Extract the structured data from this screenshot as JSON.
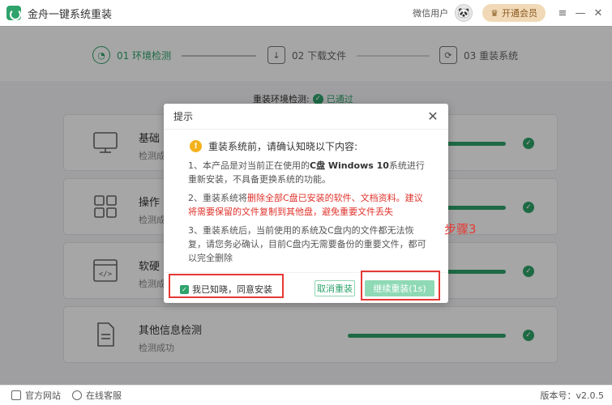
{
  "window": {
    "title": "金舟一键系统重装",
    "user_name": "微信用户",
    "vip_label": "开通会员",
    "controls": [
      "≡",
      "—",
      "✕"
    ]
  },
  "steps": [
    {
      "label": "01 环境检测",
      "active": true
    },
    {
      "label": "02 下载文件",
      "active": false
    },
    {
      "label": "03 重装系统",
      "active": false
    }
  ],
  "env": {
    "label": "重装环境检测:",
    "status": "已通过"
  },
  "cards": [
    {
      "title": "基础",
      "subtitle": "检测成",
      "icon": "monitor-icon"
    },
    {
      "title": "操作",
      "subtitle": "检测成",
      "icon": "grid-icon"
    },
    {
      "title": "软硬",
      "subtitle": "检测成",
      "icon": "code-window-icon"
    },
    {
      "title": "其他信息检测",
      "subtitle": "检测成功",
      "icon": "document-icon"
    }
  ],
  "dialog": {
    "title": "提示",
    "warning": "重装系统前，请确认知晓以下内容:",
    "p1_a": "1、本产品是对当前正在使用的",
    "p1_b": "C盘 Windows 10",
    "p1_c": "系统进行重新安装，不具备更换系统的功能。",
    "p2_a": "2、重装系统将",
    "p2_b": "删除全部C盘已安装的软件、文档资料。建议将需要保留的文件复制到其他盘，避免重要文件丢失",
    "p3": "3、重装系统后，当前使用的系统及C盘内的文件都无法恢复，请您务必确认，目前C盘内无需要备份的重要文件，都可以完全删除",
    "agree_label": "我已知晓，同意安装",
    "cancel_label": "取消重装",
    "continue_label": "继续重装(1s)"
  },
  "annotation": {
    "step_label": "步骤3",
    "color": "#e53935"
  },
  "footer": {
    "website": "官方网站",
    "support": "在线客服",
    "version": "版本号：v2.0.5"
  },
  "colors": {
    "accent": "#2ea36b",
    "warning": "#f3b21b",
    "danger": "#e0322b"
  }
}
